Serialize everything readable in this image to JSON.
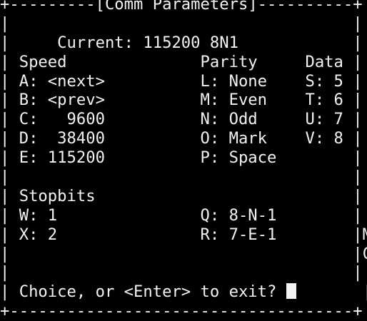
{
  "window": {
    "colors": {
      "background": "#000000",
      "foreground": "#f2f2f2"
    },
    "lines": [
      "+---------[Comm Parameters]----------+",
      "|                                    |",
      "|     Current: 115200 8N1            |",
      "| Speed              Parity     Data |",
      "| A: <next>          L: None    S: 5 |",
      "| B: <prev>          M: Even    T: 6 |",
      "| C:   9600          N: Odd     U: 7 |",
      "| D:  38400          O: Mark    V: 8 |",
      "| E: 115200          P: Space        |",
      "|                                    |",
      "| Stopbits                           |",
      "| W: 1               Q: 8-N-1        |",
      "| X: 2               R: 7-E-1        |M",
      "|                                    |C",
      "|                                    |",
      "| Choice, or <Enter> to exit? ",
      "+------------------------------------+"
    ],
    "prompt_tail": "       |"
  }
}
